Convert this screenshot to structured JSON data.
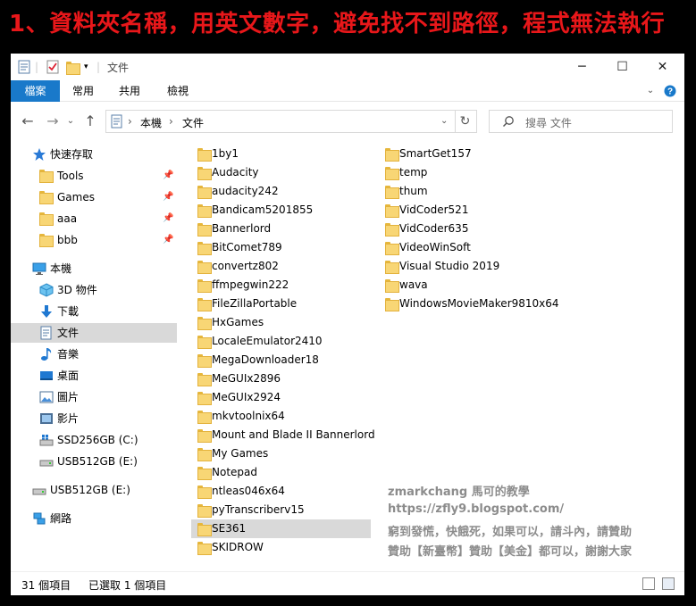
{
  "banner": {
    "text": "1、資料夾名稱，用英文數字，避免找不到路徑，程式無法執行"
  },
  "window": {
    "title": "文件",
    "controls": {
      "minimize": "─",
      "maximize": "☐",
      "close": "✕"
    }
  },
  "ribbon": {
    "tabs": [
      "檔案",
      "常用",
      "共用",
      "檢視"
    ]
  },
  "address": {
    "crumbs": [
      "本機",
      "文件"
    ],
    "separator": "›",
    "refresh_glyph": "↻",
    "search_placeholder": "搜尋 文件"
  },
  "nav": {
    "back": "←",
    "forward": "→",
    "dropdown": "⌄",
    "up": "↑"
  },
  "navpane": {
    "quick_access": "快速存取",
    "pinned": [
      "Tools",
      "Games",
      "aaa",
      "bbb"
    ],
    "this_pc": "本機",
    "pc_items": [
      "3D 物件",
      "下載",
      "文件",
      "音樂",
      "桌面",
      "圖片",
      "影片",
      "SSD256GB (C:)",
      "USB512GB (E:)"
    ],
    "usb": "USB512GB (E:)",
    "network": "網路",
    "pin_glyph": "📌"
  },
  "files": {
    "col1": [
      "1by1",
      "Audacity",
      "audacity242",
      "Bandicam5201855",
      "Bannerlord",
      "BitComet789",
      "convertz802",
      "ffmpegwin222",
      "FileZillaPortable",
      "HxGames",
      "LocaleEmulator2410",
      "MegaDownloader18",
      "MeGUIx2896",
      "MeGUIx2924",
      "mkvtoolnix64",
      "Mount and Blade II Bannerlord",
      "My Games",
      "Notepad",
      "ntleas046x64",
      "pyTranscriberv15",
      "SE361",
      "SKIDROW"
    ],
    "col2": [
      "SmartGet157",
      "temp",
      "thum",
      "VidCoder521",
      "VidCoder635",
      "VideoWinSoft",
      "Visual Studio 2019",
      "wava",
      "WindowsMovieMaker9810x64"
    ],
    "selected": "SE361"
  },
  "watermark": {
    "line1": "zmarkchang 馬可的教學",
    "line2": "https://zfly9.blogspot.com/",
    "line3": "窮到發慌，快餓死，如果可以，請斗內，請贊助",
    "line4": "贊助【新臺幣】贊助【美金】都可以，謝謝大家"
  },
  "status": {
    "count": "31 個項目",
    "selection": "已選取 1 個項目"
  },
  "colors": {
    "accent": "#1979ca",
    "banner_text": "#e8171a",
    "selected_bg": "#d9d9d9",
    "folder": "#f8d675"
  }
}
